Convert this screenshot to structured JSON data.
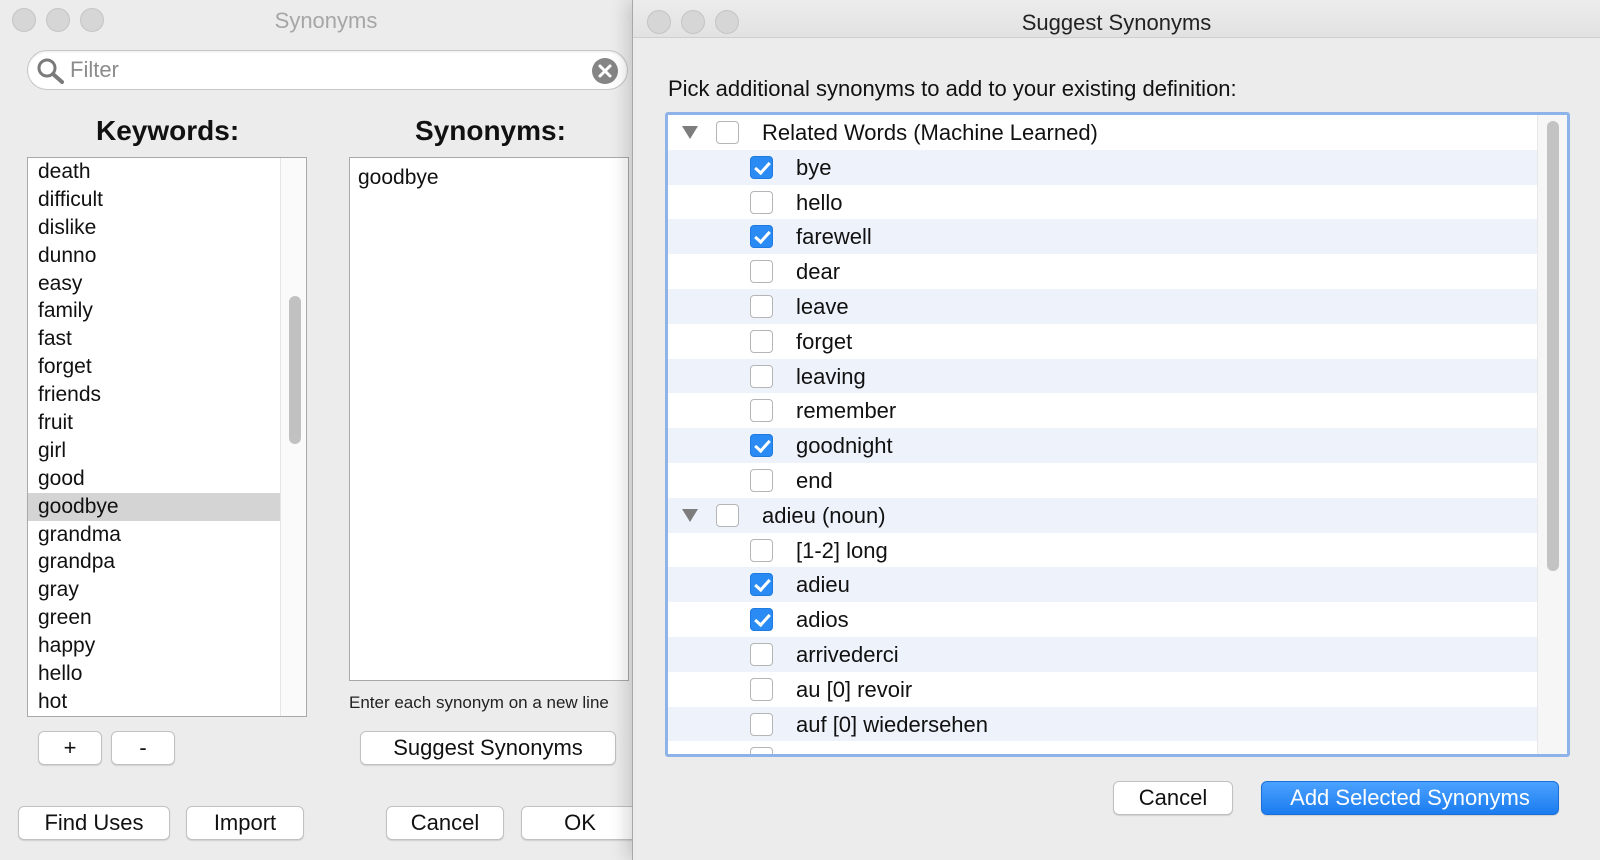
{
  "back_window": {
    "title": "Synonyms",
    "filter_placeholder": "Filter",
    "keywords_heading": "Keywords:",
    "synonyms_heading": "Synonyms:",
    "keywords": [
      "death",
      "difficult",
      "dislike",
      "dunno",
      "easy",
      "family",
      "fast",
      "forget",
      "friends",
      "fruit",
      "girl",
      "good",
      "goodbye",
      "grandma",
      "grandpa",
      "gray",
      "green",
      "happy",
      "hello",
      "hot"
    ],
    "selected_keyword": "goodbye",
    "synonyms_text": "goodbye",
    "hint": "Enter each synonym on a new line",
    "buttons": {
      "add": "+",
      "remove": "-",
      "suggest": "Suggest Synonyms",
      "find_uses": "Find Uses",
      "import": "Import",
      "cancel": "Cancel",
      "ok": "OK"
    }
  },
  "dialog": {
    "title": "Suggest Synonyms",
    "prompt": "Pick additional synonyms to add to your existing definition:",
    "rows": [
      {
        "label": "Related Words (Machine Learned)",
        "level": 0,
        "checked": false
      },
      {
        "label": "bye",
        "level": 1,
        "checked": true
      },
      {
        "label": "hello",
        "level": 1,
        "checked": false
      },
      {
        "label": "farewell",
        "level": 1,
        "checked": true
      },
      {
        "label": "dear",
        "level": 1,
        "checked": false
      },
      {
        "label": "leave",
        "level": 1,
        "checked": false
      },
      {
        "label": "forget",
        "level": 1,
        "checked": false
      },
      {
        "label": "leaving",
        "level": 1,
        "checked": false
      },
      {
        "label": "remember",
        "level": 1,
        "checked": false
      },
      {
        "label": "goodnight",
        "level": 1,
        "checked": true
      },
      {
        "label": "end",
        "level": 1,
        "checked": false
      },
      {
        "label": "adieu (noun)",
        "level": 0,
        "checked": false
      },
      {
        "label": "[1-2] long",
        "level": 1,
        "checked": false
      },
      {
        "label": "adieu",
        "level": 1,
        "checked": true
      },
      {
        "label": "adios",
        "level": 1,
        "checked": true
      },
      {
        "label": "arrivederci",
        "level": 1,
        "checked": false
      },
      {
        "label": "au [0] revoir",
        "level": 1,
        "checked": false
      },
      {
        "label": "auf [0] wiedersehen",
        "level": 1,
        "checked": false
      },
      {
        "label": "",
        "level": 1,
        "checked": false
      }
    ],
    "buttons": {
      "cancel": "Cancel",
      "add_selected": "Add Selected Synonyms"
    },
    "accent_color": "#2a8bf4"
  }
}
